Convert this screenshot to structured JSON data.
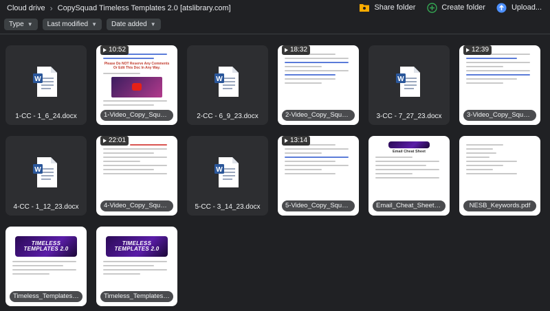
{
  "breadcrumb": {
    "root": "Cloud drive",
    "current": "CopySquad Timeless Templates 2.0 [atslibrary.com]"
  },
  "actions": {
    "share": "Share folder",
    "create": "Create folder",
    "upload": "Upload..."
  },
  "filters": [
    "Type",
    "Last modified",
    "Date added"
  ],
  "colors": {
    "background": "#202124",
    "word_blue": "#2b579a",
    "share_icon": "#f9ab00",
    "create_icon": "#34a853",
    "upload_icon": "#4d90fe"
  },
  "files": [
    {
      "name": "1-CC - 1_6_24.docx",
      "kind": "docx"
    },
    {
      "name": "1-Video_Copy_Squad...",
      "kind": "video",
      "duration": "10:52"
    },
    {
      "name": "2-CC - 6_9_23.docx",
      "kind": "docx"
    },
    {
      "name": "2-Video_Copy_Squad...",
      "kind": "video",
      "duration": "18:32"
    },
    {
      "name": "3-CC - 7_27_23.docx",
      "kind": "docx"
    },
    {
      "name": "3-Video_Copy_Squad...",
      "kind": "video",
      "duration": "12:39"
    },
    {
      "name": "4-CC - 1_12_23.docx",
      "kind": "docx"
    },
    {
      "name": "4-Video_Copy_Squad...",
      "kind": "video",
      "duration": "22:01"
    },
    {
      "name": "5-CC - 3_14_23.docx",
      "kind": "docx"
    },
    {
      "name": "5-Video_Copy_Squad...",
      "kind": "video",
      "duration": "13:14"
    },
    {
      "name": "Email_Cheat_Sheet.pdf",
      "kind": "pdf"
    },
    {
      "name": "NESB_Keywords.pdf",
      "kind": "pdf"
    },
    {
      "name": "Timeless_Templates_-...",
      "kind": "pdf"
    },
    {
      "name": "Timeless_Templates_-...",
      "kind": "pdf"
    }
  ],
  "thumbs": {
    "video1_headline": "Please Do NOT Reserve Any Comments Or Edit This Doc In Any Way.",
    "email_sheet_title": "Email Cheat Sheet",
    "banner_text": "TIMELESS TEMPLATES 2.0"
  }
}
